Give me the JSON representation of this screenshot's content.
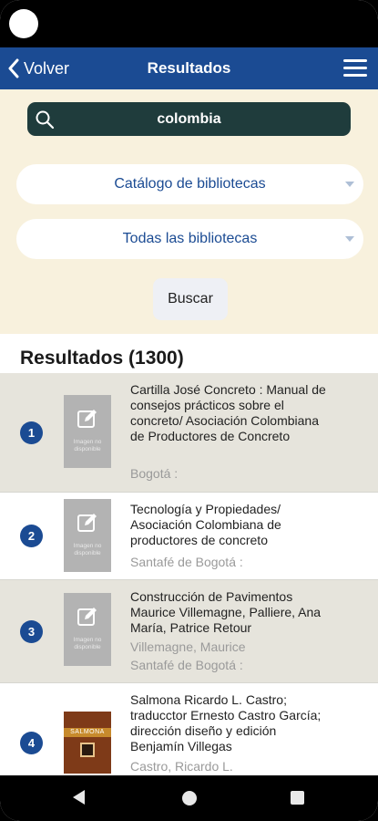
{
  "header": {
    "back_label": "Volver",
    "title": "Resultados"
  },
  "search": {
    "query": "colombia",
    "catalog_select": "Catálogo de bibliotecas",
    "library_select": "Todas las bibliotecas",
    "submit_label": "Buscar"
  },
  "results": {
    "heading": "Resultados (1300)",
    "no_image_text": "Imagen no disponible",
    "items": [
      {
        "number": "1",
        "title": "Cartilla José Concreto : Manual de consejos prácticos sobre el concreto/ Asociación Colombiana de Productores de Concreto",
        "line1": "Bogotá :",
        "line2": ""
      },
      {
        "number": "2",
        "title": "Tecnología y Propiedades/ Asociación Colombiana de productores de concreto",
        "line1": "Santafé de Bogotá :",
        "line2": ""
      },
      {
        "number": "3",
        "title": "Construcción de Pavimentos Maurice Villemagne, Palliere, Ana María, Patrice Retour",
        "line1": "Villemagne, Maurice",
        "line2": "Santafé de Bogotá :"
      },
      {
        "number": "4",
        "title": "Salmona Ricardo L. Castro; traducctor Ernesto Castro García; dirección diseño y edición Benjamín Villegas",
        "line1": "Castro, Ricardo L.",
        "line2": "",
        "cover_title": "SALMONA"
      }
    ]
  },
  "icons": {
    "back": "chevron-left-icon",
    "menu": "hamburger-menu-icon",
    "search": "search-icon",
    "no_image": "edit-icon"
  },
  "colors": {
    "app_bar": "#1b4b93",
    "search_panel": "#f8f1dd",
    "search_box": "#1f3c3c",
    "shaded_row": "#e6e4dc"
  }
}
